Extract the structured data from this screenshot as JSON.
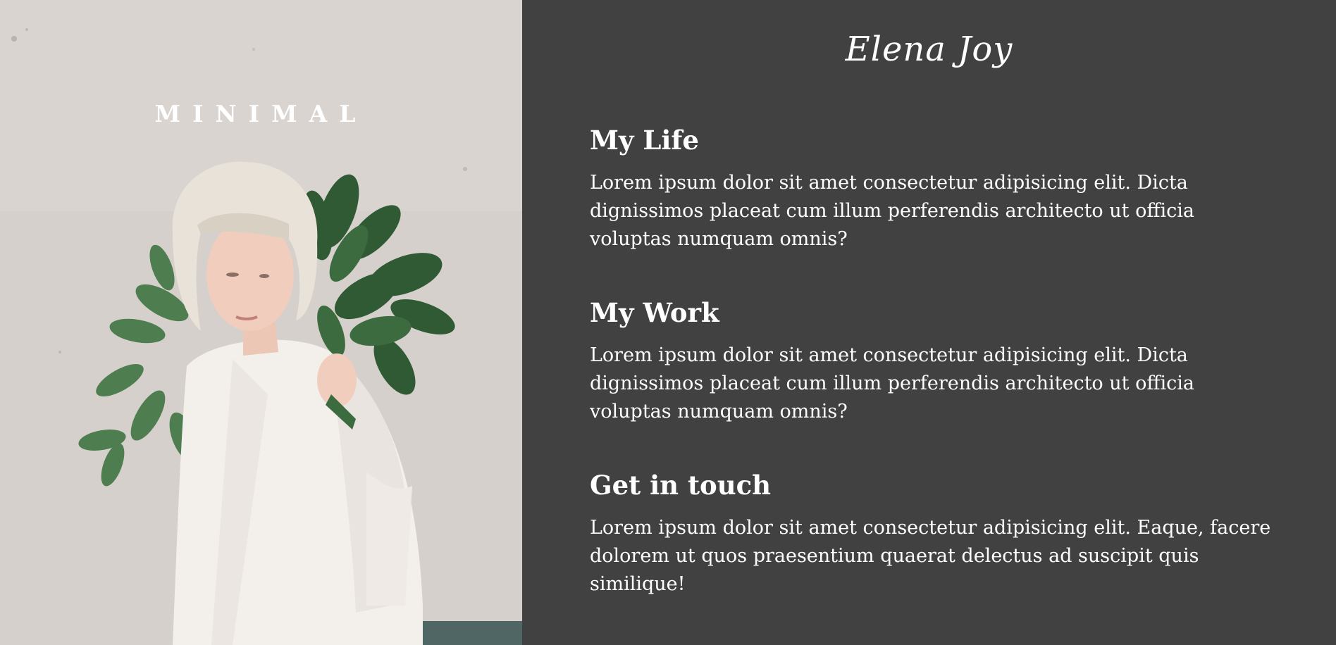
{
  "left_panel": {
    "title": "MINIMAL"
  },
  "header": {
    "brand": "Elena Joy"
  },
  "sections": [
    {
      "heading": "My Life",
      "body": "Lorem ipsum dolor sit amet consectetur adipisicing elit. Dicta dignissimos placeat cum illum perferendis architecto ut officia voluptas numquam omnis?"
    },
    {
      "heading": "My Work",
      "body": "Lorem ipsum dolor sit amet consectetur adipisicing elit. Dicta dignissimos placeat cum illum perferendis architecto ut officia voluptas numquam omnis?"
    },
    {
      "heading": "Get in touch",
      "body": "Lorem ipsum dolor sit amet consectetur adipisicing elit. Eaque, facere dolorem ut quos praesentium quaerat delectus ad suscipit quis similique!"
    }
  ],
  "colors": {
    "right_background": "#414141",
    "text": "#ffffff",
    "left_background": "#d7d1cd"
  }
}
